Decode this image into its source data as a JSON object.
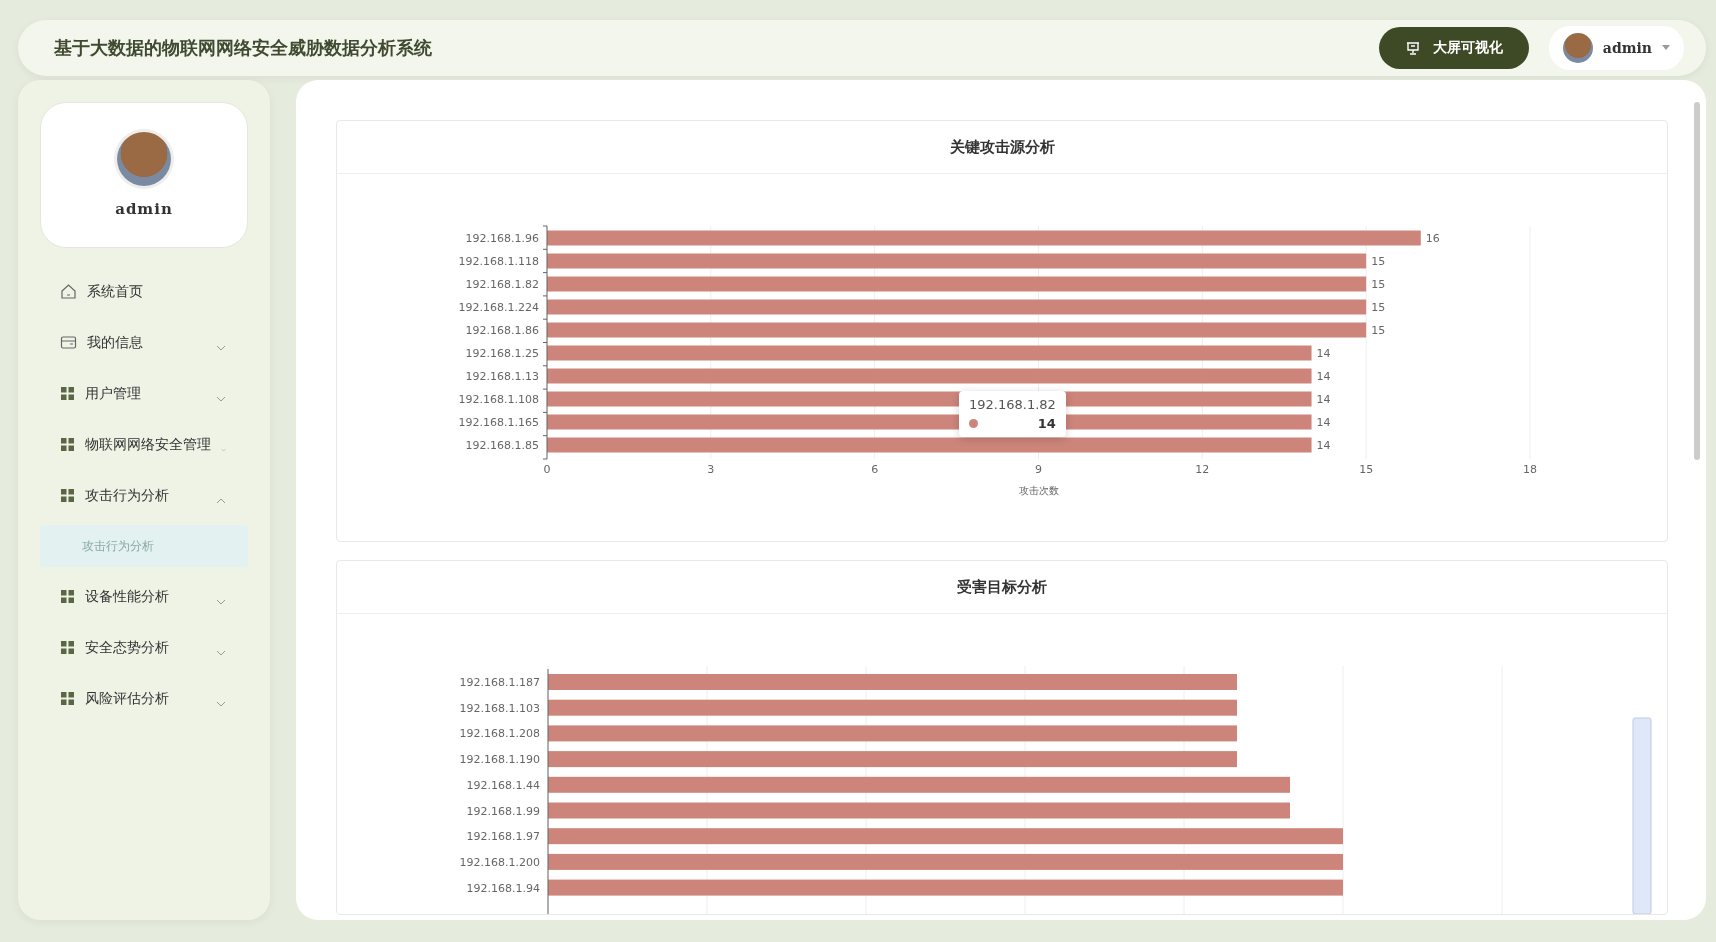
{
  "header": {
    "title": "基于大数据的物联网网络安全威胁数据分析系统",
    "screen_button": "大屏可视化",
    "user": "admin"
  },
  "sidebar": {
    "profile_name": "admin",
    "menu": [
      {
        "label": "系统首页",
        "kind": "home"
      },
      {
        "label": "我的信息",
        "kind": "profile",
        "expanded": false
      },
      {
        "label": "用户管理",
        "kind": "group",
        "expanded": false
      },
      {
        "label": "物联网网络安全管理",
        "kind": "group",
        "expanded": false
      },
      {
        "label": "攻击行为分析",
        "kind": "group",
        "expanded": true,
        "children": [
          {
            "label": "攻击行为分析",
            "selected": true
          }
        ]
      },
      {
        "label": "设备性能分析",
        "kind": "group",
        "expanded": false
      },
      {
        "label": "安全态势分析",
        "kind": "group",
        "expanded": false
      },
      {
        "label": "风险评估分析",
        "kind": "group",
        "expanded": false
      }
    ]
  },
  "source_chart": {
    "title": "关键攻击源分析",
    "chart_data": {
      "type": "bar",
      "orientation": "horizontal",
      "grid": true,
      "xlabel": "攻击次数",
      "data_labels": true,
      "xlim": [
        0,
        18
      ],
      "xticks": [
        0,
        3,
        6,
        9,
        12,
        15,
        18
      ],
      "categories": [
        "192.168.1.96",
        "192.168.1.118",
        "192.168.1.82",
        "192.168.1.224",
        "192.168.1.86",
        "192.168.1.25",
        "192.168.1.13",
        "192.168.1.108",
        "192.168.1.165",
        "192.168.1.85"
      ],
      "values": [
        16,
        15,
        15,
        15,
        15,
        14,
        14,
        14,
        14,
        14
      ]
    },
    "tooltip": {
      "title": "192.168.1.82",
      "value": "14"
    }
  },
  "target_chart": {
    "title": "受害目标分析",
    "kind": "picture",
    "categories": [
      "192.168.1.187",
      "192.168.1.103",
      "192.168.1.208",
      "192.168.1.190",
      "192.168.1.44",
      "192.168.1.99",
      "192.168.1.97",
      "192.168.1.200",
      "192.168.1.94"
    ]
  }
}
